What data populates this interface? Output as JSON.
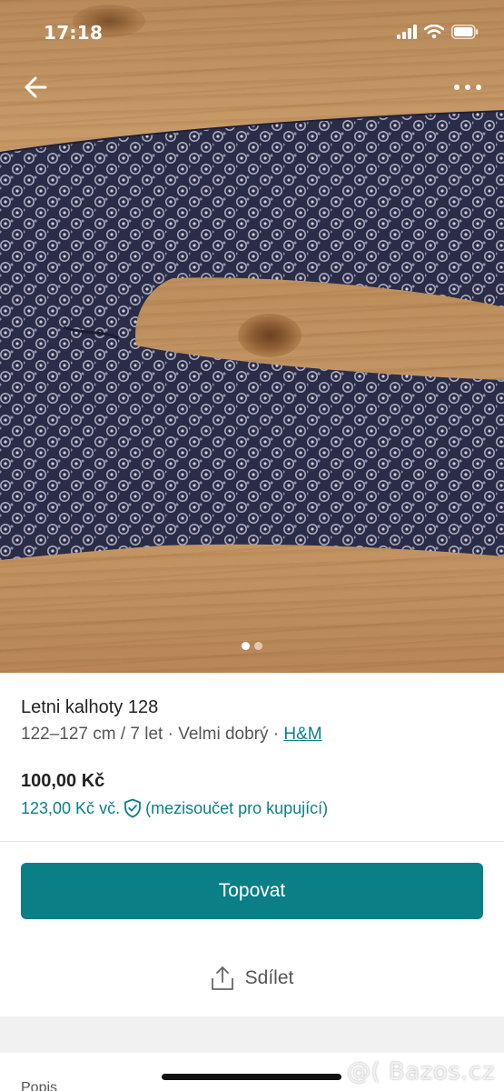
{
  "status_bar": {
    "time": "17:18"
  },
  "gallery": {
    "image_count": 2,
    "active_index": 0
  },
  "item": {
    "title": "Letni kalhoty 128",
    "size": "122–127 cm / 7 let",
    "separator": " · ",
    "condition": "Velmi dobrý",
    "brand": "H&M",
    "price": "100,00 Kč",
    "total_price": "123,00 Kč vč.",
    "total_note": "(mezisoučet pro kupující)"
  },
  "actions": {
    "promote_label": "Topovat",
    "share_label": "Sdílet"
  },
  "sections": {
    "peek_label": "Popis"
  },
  "watermark": "@( Bazos.cz",
  "colors": {
    "accent": "#0b7f86"
  }
}
